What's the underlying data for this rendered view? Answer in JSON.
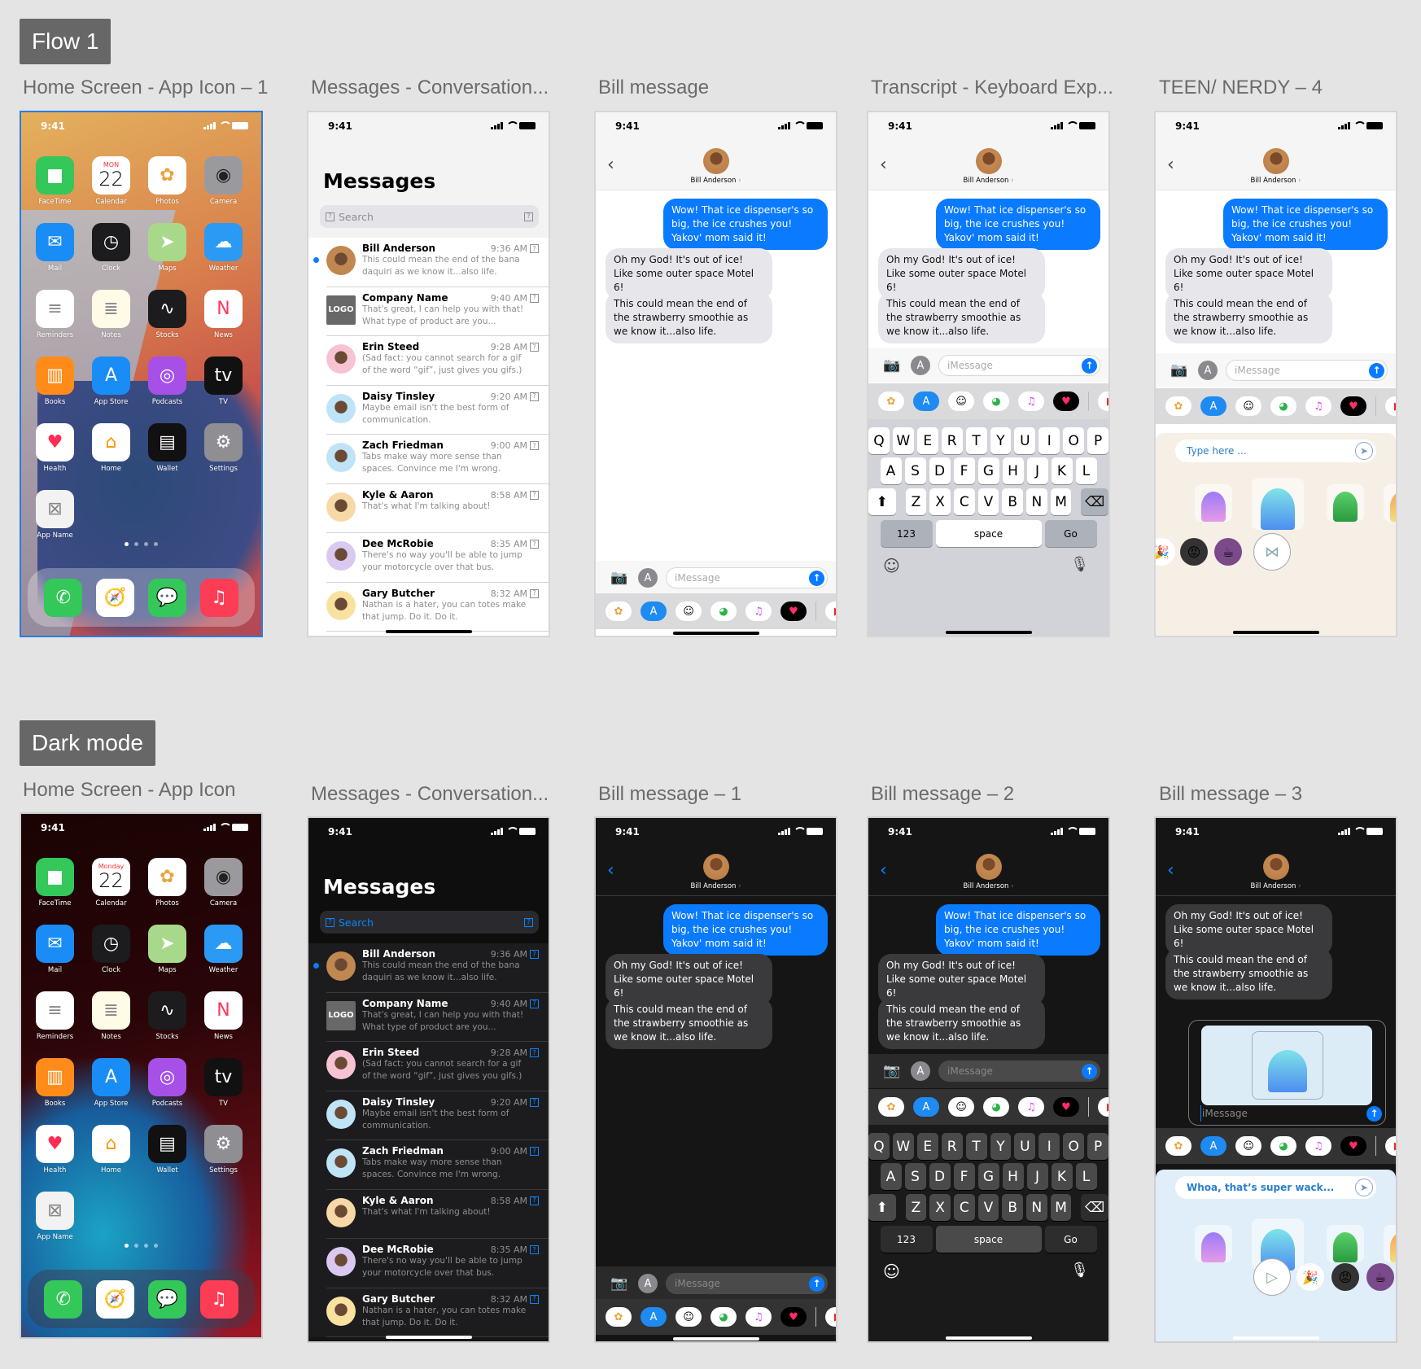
{
  "sections": {
    "flow": {
      "tag": "Flow 1"
    },
    "dark": {
      "tag": "Dark mode"
    }
  },
  "frames": {
    "light_home": {
      "label": "Home Screen - App Icon – 1"
    },
    "light_messages": {
      "label": "Messages - Conversation..."
    },
    "light_bill": {
      "label": "Bill message"
    },
    "light_keyboard": {
      "label": "Transcript - Keyboard Exp..."
    },
    "light_teen": {
      "label": "TEEN/ NERDY – 4"
    },
    "dark_home": {
      "label": "Home Screen - App Icon"
    },
    "dark_messages": {
      "label": "Messages - Conversation..."
    },
    "dark_bill1": {
      "label": "Bill message – 1"
    },
    "dark_bill2": {
      "label": "Bill message – 2"
    },
    "dark_bill3": {
      "label": "Bill message – 3"
    }
  },
  "status": {
    "time": "9:41"
  },
  "home": {
    "apps": [
      {
        "name": "FaceTime",
        "icon": "facetime-icon",
        "bg": "#34c759",
        "glyph": "■"
      },
      {
        "name": "Calendar",
        "icon": "calendar-icon",
        "bg": "#ffffff",
        "glyph": "22"
      },
      {
        "name": "Photos",
        "icon": "photos-icon",
        "bg": "#ffffff",
        "glyph": "✿"
      },
      {
        "name": "Camera",
        "icon": "camera-icon",
        "bg": "#9a9a9e",
        "glyph": "◉"
      },
      {
        "name": "Mail",
        "icon": "mail-icon",
        "bg": "#1a8cf5",
        "glyph": "✉"
      },
      {
        "name": "Clock",
        "icon": "clock-icon",
        "bg": "#1c1c1e",
        "glyph": "◷"
      },
      {
        "name": "Maps",
        "icon": "maps-icon",
        "bg": "#a8d98a",
        "glyph": "➤"
      },
      {
        "name": "Weather",
        "icon": "weather-icon",
        "bg": "#2a9af5",
        "glyph": "☁"
      },
      {
        "name": "Reminders",
        "icon": "reminders-icon",
        "bg": "#ffffff",
        "glyph": "≡"
      },
      {
        "name": "Notes",
        "icon": "notes-icon",
        "bg": "#fffbe6",
        "glyph": "≣"
      },
      {
        "name": "Stocks",
        "icon": "stocks-icon",
        "bg": "#1c1c1e",
        "glyph": "∿"
      },
      {
        "name": "News",
        "icon": "news-icon",
        "bg": "#ffffff",
        "glyph": "N"
      },
      {
        "name": "Books",
        "icon": "books-icon",
        "bg": "#ff8c1a",
        "glyph": "▥"
      },
      {
        "name": "App Store",
        "icon": "app-store-icon",
        "bg": "#1a8cf5",
        "glyph": "A"
      },
      {
        "name": "Podcasts",
        "icon": "podcasts-icon",
        "bg": "#a650e8",
        "glyph": "◎"
      },
      {
        "name": "TV",
        "icon": "tv-icon",
        "bg": "#111111",
        "glyph": "tv"
      },
      {
        "name": "Health",
        "icon": "health-icon",
        "bg": "#ffffff",
        "glyph": "♥"
      },
      {
        "name": "Home",
        "icon": "home-app-icon",
        "bg": "#ffffff",
        "glyph": "⌂"
      },
      {
        "name": "Wallet",
        "icon": "wallet-icon",
        "bg": "#111111",
        "glyph": "▤"
      },
      {
        "name": "Settings",
        "icon": "settings-icon",
        "bg": "#8e8e93",
        "glyph": "⚙"
      },
      {
        "name": "App Name",
        "icon": "placeholder-app-icon",
        "bg": "#f2f2f2",
        "glyph": "⊠"
      }
    ],
    "calendar_day_light": "MON",
    "calendar_day_dark": "Monday",
    "calendar_date": "22",
    "dock": [
      {
        "icon": "phone-icon",
        "bg": "#34c759",
        "glyph": "✆"
      },
      {
        "icon": "safari-icon",
        "bg": "#ffffff",
        "glyph": "🧭"
      },
      {
        "icon": "messages-icon",
        "bg": "#34c759",
        "glyph": "💬"
      },
      {
        "icon": "music-icon",
        "bg": "#fc3d55",
        "glyph": "♫"
      }
    ]
  },
  "messages": {
    "title": "Messages",
    "search_placeholder": "Search",
    "conversations": [
      {
        "name": "Bill Anderson",
        "time": "9:36 AM",
        "preview": "This could mean the end of the bana daquiri as we know it...also life.",
        "unread": true,
        "avatar": "#c08850"
      },
      {
        "name": "Company Name",
        "time": "9:40 AM",
        "preview": "That's great, I can help you with that! What type of product are you...",
        "unread": false,
        "avatar": "logo",
        "logo_text": "LOGO"
      },
      {
        "name": "Erin Steed",
        "time": "9:28 AM",
        "preview": "(Sad fact: you cannot search for a gif of the word “gif”, just gives you gifs.)",
        "unread": false,
        "avatar": "#f7c3d3"
      },
      {
        "name": "Daisy Tinsley",
        "time": "9:20 AM",
        "preview": "Maybe email isn't the best form of communication.",
        "unread": false,
        "avatar": "#bfe4f7"
      },
      {
        "name": "Zach Friedman",
        "time": "9:00 AM",
        "preview": "Tabs make way more sense than spaces. Convince me I'm wrong.",
        "unread": false,
        "avatar": "#bfe4f7"
      },
      {
        "name": "Kyle & Aaron",
        "time": "8:58 AM",
        "preview": "That's what I'm talking about!",
        "unread": false,
        "avatar": "#f7d9a8"
      },
      {
        "name": "Dee McRobie",
        "time": "8:35 AM",
        "preview": "There's no way you'll be able to jump your motorcycle over that bus.",
        "unread": false,
        "avatar": "#d9c9f0"
      },
      {
        "name": "Gary Butcher",
        "time": "8:32 AM",
        "preview": "Nathan is a hater, you can totes make that jump. Do it. Do it.",
        "unread": false,
        "avatar": "#f9e2a0"
      }
    ]
  },
  "chat": {
    "contact": "Bill Anderson",
    "outgoing": "Wow! That ice dispenser's so big, the  ice crushes you! Yakov' mom said it!",
    "incoming": [
      "Oh my God! It's out of ice! Like some outer space Motel 6!",
      "This could mean the end of the strawberry smoothie as we know it...also life."
    ],
    "input_placeholder": "iMessage"
  },
  "drawer_apps": [
    {
      "icon": "photos-app-icon",
      "style": "",
      "glyph": "✿"
    },
    {
      "icon": "app-store-app-icon",
      "style": "blue",
      "glyph": "A"
    },
    {
      "icon": "memoji-icon",
      "style": "",
      "glyph": "☺"
    },
    {
      "icon": "monster-app-icon",
      "style": "",
      "glyph": "◕"
    },
    {
      "icon": "music-app-icon",
      "style": "",
      "glyph": "♫"
    },
    {
      "icon": "heart-app-icon",
      "style": "black",
      "glyph": "♥"
    },
    {
      "icon": "youtube-icon",
      "style": "",
      "glyph": "▶"
    }
  ],
  "keyboard": {
    "row1": [
      "Q",
      "W",
      "E",
      "R",
      "T",
      "Y",
      "U",
      "I",
      "O",
      "P"
    ],
    "row2": [
      "A",
      "S",
      "D",
      "F",
      "G",
      "H",
      "J",
      "K",
      "L"
    ],
    "row3": [
      "Z",
      "X",
      "C",
      "V",
      "B",
      "N",
      "M"
    ],
    "numbers": "123",
    "space": "space",
    "go": "Go"
  },
  "sticker_panel": {
    "light_placeholder": "Type here ...",
    "dark_text": "Whoa, that’s super wack..."
  },
  "colors": {
    "accent": "#0a7aff",
    "tag_bg": "#676767"
  }
}
